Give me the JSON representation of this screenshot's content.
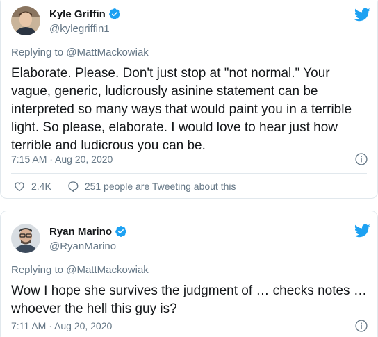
{
  "tweets": [
    {
      "name": "Kyle Griffin",
      "handle": "@kylegriffin1",
      "replying_label": "Replying to",
      "replying_to": "@MattMackowiak",
      "text": "Elaborate. Please. Don't just stop at \"not normal.\" Your vague, generic, ludicrously asinine statement can be interpreted so many ways that would paint you in a terrible light. So please, elaborate. I would love to hear just how terrible and ludicrous you can be.",
      "timestamp": "7:15 AM · Aug 20, 2020",
      "likes": "2.4K",
      "conversation": "251 people are Tweeting about this"
    },
    {
      "name": "Ryan Marino",
      "handle": "@RyanMarino",
      "replying_label": "Replying to",
      "replying_to": "@MattMackowiak",
      "text": "Wow I hope she survives the judgment of … checks notes … whoever the hell this guy is?",
      "timestamp": "7:11 AM · Aug 20, 2020"
    }
  ],
  "colors": {
    "twitter_blue": "#1da1f2",
    "text_primary": "#14171a",
    "text_secondary": "#657786",
    "border": "#e1e8ed"
  },
  "icons": {
    "verified": "verified-badge-icon",
    "bird": "twitter-bird-icon",
    "info": "info-icon",
    "like": "heart-icon",
    "conversation": "speech-bubble-icon"
  }
}
